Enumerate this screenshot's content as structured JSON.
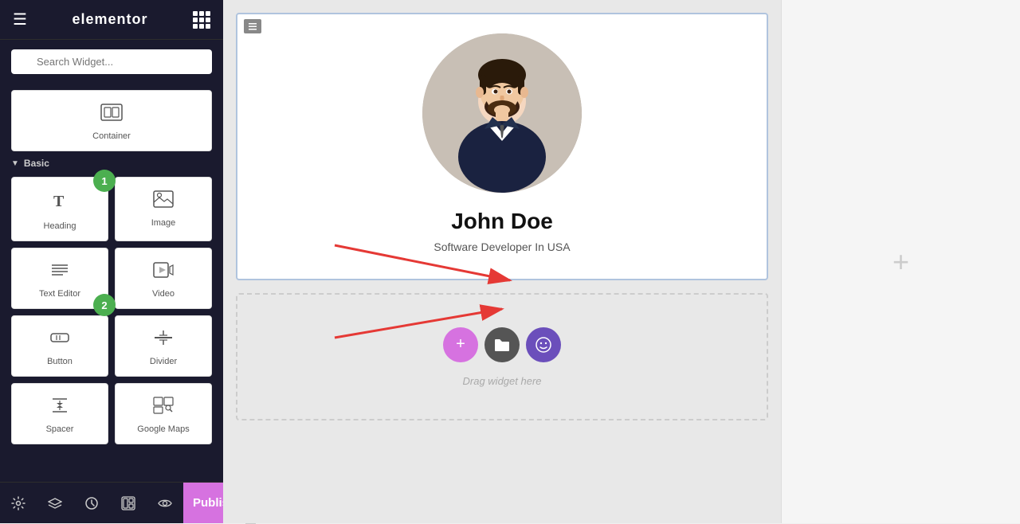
{
  "header": {
    "menu_icon": "☰",
    "logo": "elementor",
    "grid_icon": "grid"
  },
  "search": {
    "placeholder": "Search Widget..."
  },
  "widgets": {
    "container": {
      "label": "Container",
      "icon": "container"
    },
    "section_basic": "Basic",
    "basic_items": [
      {
        "id": "heading",
        "label": "Heading",
        "icon": "T"
      },
      {
        "id": "image",
        "label": "Image",
        "icon": "img"
      },
      {
        "id": "text_editor",
        "label": "Text Editor",
        "icon": "text"
      },
      {
        "id": "video",
        "label": "Video",
        "icon": "video"
      },
      {
        "id": "button",
        "label": "Button",
        "icon": "button"
      },
      {
        "id": "divider",
        "label": "Divider",
        "icon": "divider"
      },
      {
        "id": "spacer",
        "label": "Spacer",
        "icon": "spacer"
      },
      {
        "id": "gallery",
        "label": "Google Maps",
        "icon": "gallery"
      }
    ]
  },
  "badges": {
    "badge1": "1",
    "badge2": "2"
  },
  "bottom_bar": {
    "icons": [
      "settings",
      "layers",
      "history",
      "template",
      "eye"
    ],
    "publish_label": "Publish",
    "chevron": "▲"
  },
  "canvas": {
    "person_name": "John Doe",
    "person_title": "Software Developer In USA",
    "drop_text": "Drag widget here",
    "plus_label": "+"
  },
  "arrows": {
    "arrow1_from": "heading",
    "arrow1_to": "person_name",
    "arrow2_from": "text_editor",
    "arrow2_to": "person_title"
  }
}
